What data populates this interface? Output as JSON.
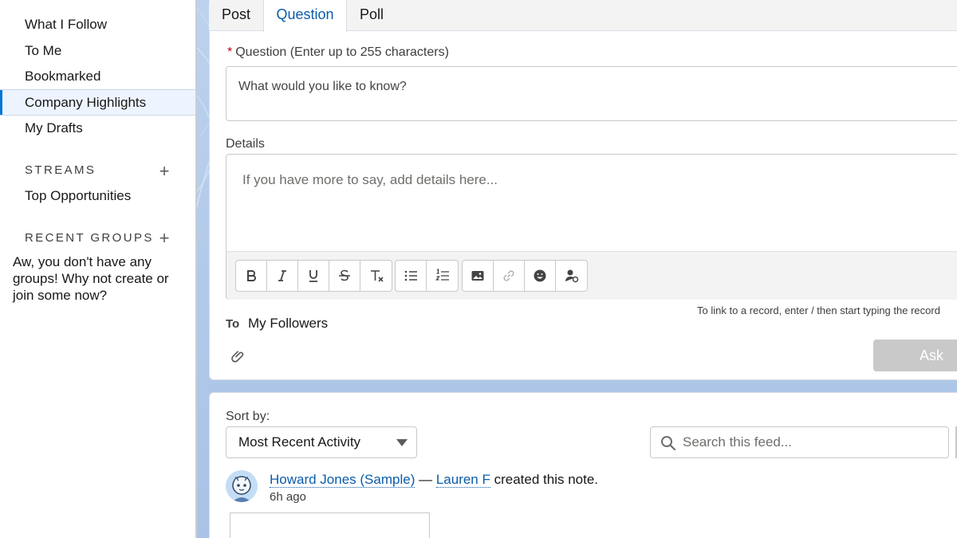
{
  "nav": {
    "items": [
      {
        "label": "What I Follow"
      },
      {
        "label": "To Me"
      },
      {
        "label": "Bookmarked"
      },
      {
        "label": "Company Highlights"
      },
      {
        "label": "My Drafts"
      }
    ],
    "active_item": "Company Highlights",
    "streams_heading": "STREAMS",
    "streams": [
      {
        "label": "Top Opportunities"
      }
    ],
    "groups_heading": "RECENT GROUPS",
    "groups_empty": "Aw, you don't have any groups! Why not create or join some now?"
  },
  "publisher": {
    "tabs": [
      {
        "label": "Post"
      },
      {
        "label": "Question"
      },
      {
        "label": "Poll"
      }
    ],
    "active_tab": "Question",
    "required_mark": "*",
    "question_label": "Question (Enter up to 255 characters)",
    "question_placeholder": "What would you like to know?",
    "details_label": "Details",
    "details_placeholder": "If you have more to say, add details here...",
    "toolbar_icons": [
      "bold-icon",
      "italic-icon",
      "underline-icon",
      "strikethrough-icon",
      "remove-formatting-icon",
      "bulleted-list-icon",
      "numbered-list-icon",
      "image-icon",
      "link-icon",
      "emoji-icon",
      "mention-icon"
    ],
    "hint": "To link to a record, enter / then start typing the record",
    "to_label": "To",
    "to_value": "My Followers",
    "ask_label": "Ask"
  },
  "feed": {
    "sort_label": "Sort by:",
    "sort_value": "Most Recent Activity",
    "search_placeholder": "Search this feed...",
    "post": {
      "author": "Howard Jones (Sample)",
      "separator": "—",
      "actor": "Lauren F",
      "action": "created this note.",
      "time": "6h ago"
    }
  },
  "colors": {
    "link": "#0b5cab",
    "required": "#ba0517",
    "ask_disabled": "#c9c9c9",
    "background": "#a9c3e6"
  }
}
